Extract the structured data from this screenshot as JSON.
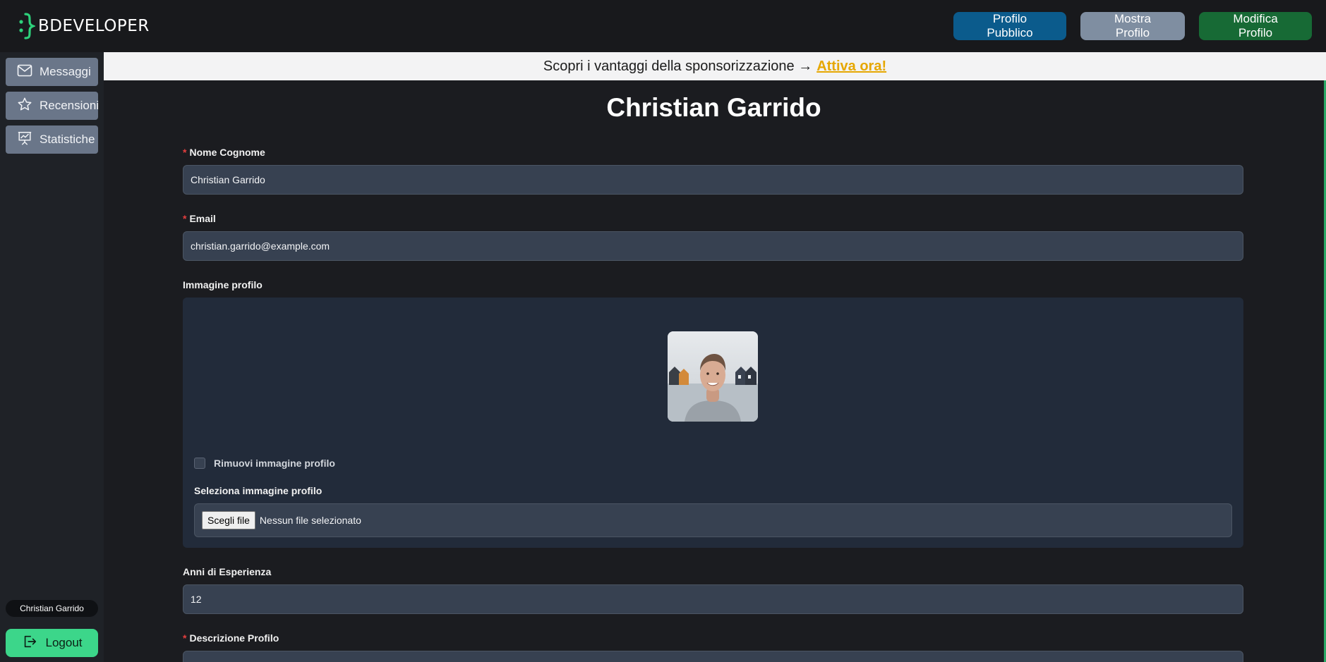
{
  "brand": {
    "name": "BDEVELOPER",
    "accent": "#2dd07a"
  },
  "navbar": {
    "public_profile": "Profilo Pubblico",
    "show_profile": "Mostra Profilo",
    "edit_profile": "Modifica Profilo"
  },
  "sidebar": {
    "items": [
      {
        "label": "Messaggi",
        "icon": "envelope-icon"
      },
      {
        "label": "Recensioni",
        "icon": "star-icon"
      },
      {
        "label": "Statistiche",
        "icon": "presentation-chart-icon"
      }
    ],
    "user_name": "Christian Garrido",
    "logout": "Logout"
  },
  "banner": {
    "text": "Scopri i vantaggi della sponsorizzazione →",
    "link": "Attiva ora!"
  },
  "form": {
    "title": "Christian Garrido",
    "name_label": "Nome Cognome",
    "name_value": "Christian Garrido",
    "email_label": "Email",
    "email_value": "christian.garrido@example.com",
    "image_label": "Immagine profilo",
    "remove_image_label": "Rimuovi immagine profilo",
    "select_image_label": "Seleziona immagine profilo",
    "file_button": "Scegli file",
    "file_status": "Nessun file selezionato",
    "experience_label": "Anni di Esperienza",
    "experience_value": "12",
    "description_label": "Descrizione Profilo",
    "required_marker": "*"
  }
}
